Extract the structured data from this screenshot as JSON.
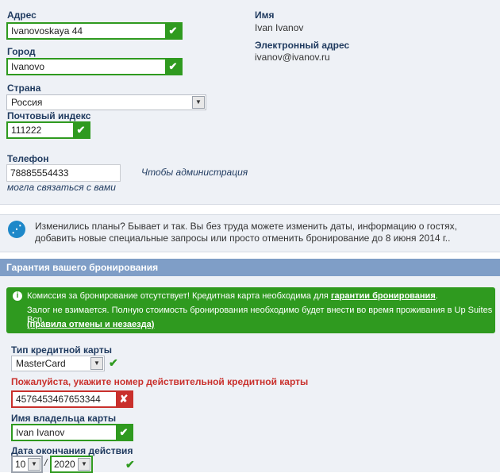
{
  "address": {
    "address_label": "Адрес",
    "address_value": "Ivanovoskaya 44",
    "city_label": "Город",
    "city_value": "Ivanovo",
    "country_label": "Страна",
    "country_value": "Россия",
    "postal_label": "Почтовый индекс",
    "postal_value": "111222",
    "phone_label": "Телефон",
    "phone_value": "78885554433",
    "phone_hint_1": "Чтобы администрация",
    "phone_hint_2": "могла связаться с вами",
    "check_glyph": "✔"
  },
  "profile": {
    "name_label": "Имя",
    "name_value": "Ivan Ivanov",
    "email_label": "Электронный адрес",
    "email_value": "ivanov@ivanov.ru"
  },
  "info": {
    "icon": "⋰",
    "text": "Изменились планы? Бывает и так. Вы без труда можете изменить даты, информацию о гостях, добавить новые специальные запросы или просто отменить бронирование до 8 июня 2014 г.."
  },
  "guarantee": {
    "title": "Гарантия вашего бронирования",
    "notice_icon": "i",
    "notice_line1_text": "Комиссия за бронирование отсутствует! Кредитная карта необходима для ",
    "notice_line1_link": "гарантии бронирования",
    "notice_line1_end": ".",
    "notice_line2": "Залог не взимается. Полную стоимость бронирования необходимо будет внести во время проживания в Up Suites Bcn.",
    "notice_link2": "(правила отмены и незаезда)",
    "card_type_label": "Тип кредитной карты",
    "card_type_value": "MasterCard",
    "card_error_label": "Пожалуйста, укажите номер действительной кредитной карты",
    "card_number_value": "4576453467653344",
    "error_glyph": "✘",
    "holder_label": "Имя владельца карты",
    "holder_value": "Ivan Ivanov",
    "expiry_label": "Дата окончания действия",
    "expiry_month": "10",
    "expiry_separator": "/",
    "expiry_year": "2020",
    "tick_glyph": "✔",
    "arrow_glyph": "▼"
  },
  "colors": {
    "success": "#2f9a1f",
    "error": "#c9302c",
    "section_bar": "#7f9ec7",
    "panel_bg": "#eef1f6",
    "label_navy": "#1f3a5f"
  }
}
